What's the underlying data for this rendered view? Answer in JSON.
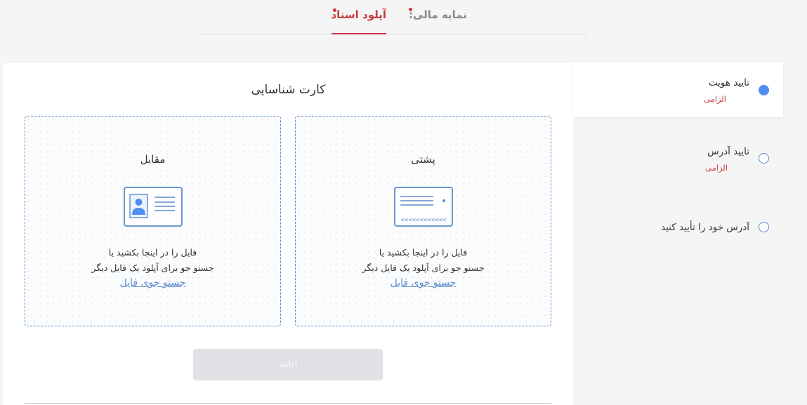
{
  "tabs": {
    "finance": "نمایه مالی:",
    "upload": "آپلود اسناد"
  },
  "panel": {
    "title": "کارت شناسایی"
  },
  "dropzones": {
    "front": {
      "label": "مقابل",
      "line1": "فایل را در اینجا بکشید یا",
      "line2": "جستو جو برای آپلود یک فایل دیگر",
      "link": "جستو جوی فایل",
      "icon": "id-card-front-icon"
    },
    "back": {
      "label": "پشتی",
      "line1": "فایل را در اینجا بکشید یا",
      "line2": "جستو جو برای آپلود یک فایل دیگر",
      "link": "جستو جوی فایل",
      "icon": "id-card-back-icon"
    }
  },
  "continue_label": "ادامه",
  "steps": [
    {
      "title": "تایید هویت",
      "required": "الزامی",
      "active": true
    },
    {
      "title": "تایید آدرس",
      "required": "الزامی",
      "active": false
    },
    {
      "title": "آدرس خود را تأیید کنید",
      "required": "",
      "active": false
    }
  ],
  "colors": {
    "accent_red": "#c8383b",
    "accent_blue": "#5b8ccb",
    "active_dot": "#4f8ef0"
  }
}
